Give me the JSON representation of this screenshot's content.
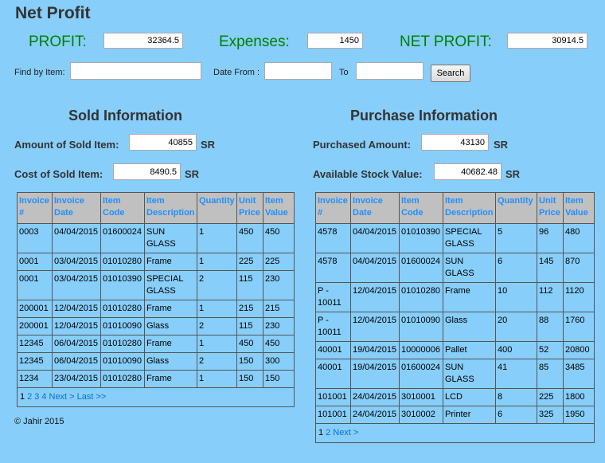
{
  "page": {
    "title": "Net Profit"
  },
  "summary": {
    "profit_label": "PROFIT:",
    "profit_value": "32364.5",
    "expenses_label": "Expenses:",
    "expenses_value": "1450",
    "net_label": "NET PROFIT:",
    "net_value": "30914.5"
  },
  "filters": {
    "find_label": "Find by Item:",
    "find_value": "",
    "date_from_label": "Date From :",
    "date_from_value": "",
    "to_label": "To",
    "to_value": "",
    "search_label": "Search"
  },
  "sold": {
    "title": "Sold Information",
    "amount_label": "Amount of Sold Item:",
    "amount_value": "40855",
    "cost_label": "Cost of Sold Item:",
    "cost_value": "8490.5",
    "currency": "SR",
    "columns": [
      "Invoice #",
      "Invoice Date",
      "Item Code",
      "Item Description",
      "Quantity",
      "Unit Price",
      "Item Value"
    ],
    "rows": [
      [
        "0003",
        "04/04/2015",
        "01600024",
        "SUN GLASS",
        "1",
        "450",
        "450"
      ],
      [
        "0001",
        "03/04/2015",
        "01010280",
        "Frame",
        "1",
        "225",
        "225"
      ],
      [
        "0001",
        "03/04/2015",
        "01010390",
        "SPECIAL GLASS",
        "2",
        "115",
        "230"
      ],
      [
        "200001",
        "12/04/2015",
        "01010280",
        "Frame",
        "1",
        "215",
        "215"
      ],
      [
        "200001",
        "12/04/2015",
        "01010090",
        "Glass",
        "2",
        "115",
        "230"
      ],
      [
        "12345",
        "06/04/2015",
        "01010280",
        "Frame",
        "1",
        "450",
        "450"
      ],
      [
        "12345",
        "06/04/2015",
        "01010090",
        "Glass",
        "2",
        "150",
        "300"
      ],
      [
        "1234",
        "23/04/2015",
        "01010280",
        "Frame",
        "1",
        "150",
        "150"
      ]
    ],
    "pager": {
      "current": "1",
      "pages": [
        "2",
        "3",
        "4"
      ],
      "next": "Next >",
      "last": "Last >>"
    }
  },
  "purchase": {
    "title": "Purchase Information",
    "amount_label": "Purchased Amount:",
    "amount_value": "43130",
    "stock_label": "Available Stock Value:",
    "stock_value": "40682.48",
    "currency": "SR",
    "columns": [
      "Invoice #",
      "Invoice Date",
      "Item Code",
      "Item Description",
      "Quantity",
      "Unit Price",
      "Item Value"
    ],
    "rows": [
      [
        "4578",
        "04/04/2015",
        "01010390",
        "SPECIAL GLASS",
        "5",
        "96",
        "480"
      ],
      [
        "4578",
        "04/04/2015",
        "01600024",
        "SUN GLASS",
        "6",
        "145",
        "870"
      ],
      [
        "P - 10011",
        "12/04/2015",
        "01010280",
        "Frame",
        "10",
        "112",
        "1120"
      ],
      [
        "P - 10011",
        "12/04/2015",
        "01010090",
        "Glass",
        "20",
        "88",
        "1760"
      ],
      [
        "40001",
        "19/04/2015",
        "10000006",
        "Pallet",
        "400",
        "52",
        "20800"
      ],
      [
        "40001",
        "19/04/2015",
        "01600024",
        "SUN GLASS",
        "41",
        "85",
        "3485"
      ],
      [
        "101001",
        "24/04/2015",
        "3010001",
        "LCD",
        "8",
        "225",
        "1800"
      ],
      [
        "101001",
        "24/04/2015",
        "3010002",
        "Printer",
        "6",
        "325",
        "1950"
      ]
    ],
    "pager": {
      "current": "1",
      "pages": [
        "2"
      ],
      "next": "Next >"
    }
  },
  "footer": {
    "text": "© Jahir 2015"
  }
}
